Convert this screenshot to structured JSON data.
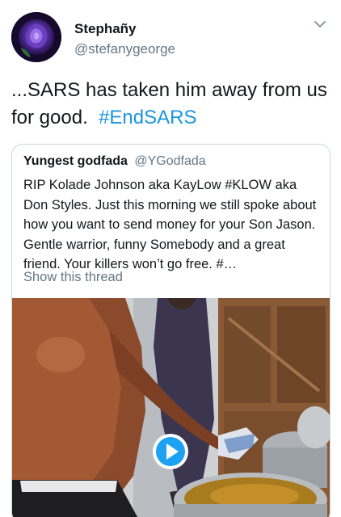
{
  "tweet": {
    "display_name": "Stephañy",
    "handle": "@stefanygeorge",
    "text": "...SARS has taken him away from us for good.",
    "hashtag": "#EndSARS"
  },
  "quoted_tweet": {
    "display_name": "Yungest godfada",
    "handle": "@YGodfada",
    "text": "RIP Kolade Johnson aka KayLow #KLOW aka Don Styles. Just this morning we still spoke about how you want to send money for your Son Jason. Gentle warrior, funny Somebody and a great friend. Your killers won’t go free. #…",
    "show_thread_label": "Show this thread"
  },
  "icons": {
    "menu": "chevron-down-icon",
    "play": "play-icon"
  },
  "colors": {
    "link": "#1b95e0",
    "secondary_text": "#657786",
    "play_button": "#1da1f2"
  }
}
